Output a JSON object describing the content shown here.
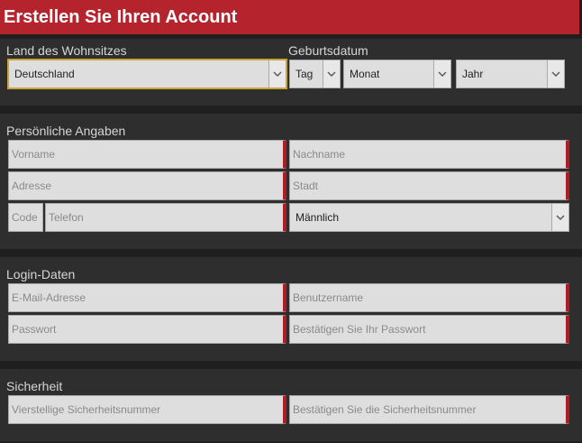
{
  "header": {
    "title": "Erstellen Sie Ihren Account"
  },
  "residence": {
    "label": "Land des Wohnsitzes",
    "country": "Deutschland"
  },
  "birthdate": {
    "label": "Geburtsdatum",
    "day": "Tag",
    "month": "Monat",
    "year": "Jahr"
  },
  "personal": {
    "label": "Persönliche Angaben",
    "first_name": "Vorname",
    "last_name": "Nachname",
    "address": "Adresse",
    "city": "Stadt",
    "code": "Code",
    "phone": "Telefon",
    "gender": "Männlich"
  },
  "login": {
    "label": "Login-Daten",
    "email": "E-Mail-Adresse",
    "username": "Benutzername",
    "password": "Passwort",
    "confirm_password": "Bestätigen Sie Ihr Passwort"
  },
  "security": {
    "label": "Sicherheit",
    "pin": "Vierstellige Sicherheitsnummer",
    "confirm_pin": "Bestätigen Sie die Sicherheitsnummer"
  },
  "colors": {
    "accent": "#b5242c",
    "required_marker": "#b01c23",
    "panel": "#2e2e2e",
    "background": "#1f1f1f",
    "input": "#dedede"
  }
}
